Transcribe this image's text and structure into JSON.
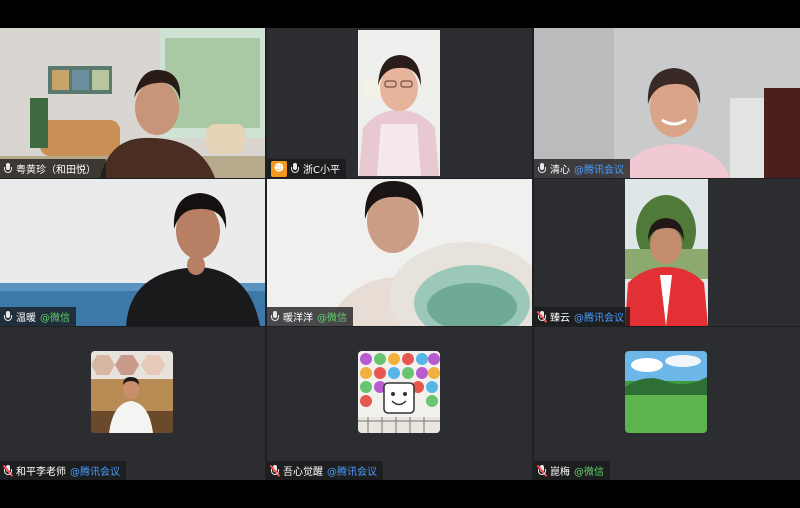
{
  "participants": [
    {
      "name": "粤黄珍（和田悦）",
      "org": ""
    },
    {
      "name": "浙C小平",
      "org": ""
    },
    {
      "name": "清心",
      "org": "@腾讯会议"
    },
    {
      "name": "温暖",
      "org": "@微信"
    },
    {
      "name": "暖洋洋",
      "org": "@微信"
    },
    {
      "name": "臻云",
      "org": "@腾讯会议"
    },
    {
      "name": "和平李老师",
      "org": "@腾讯会议"
    },
    {
      "name": "吾心觉醒",
      "org": "@腾讯会议"
    },
    {
      "name": "崑梅",
      "org": "@微信"
    }
  ],
  "colors": {
    "active_speaker_border": "#2fbf71",
    "wechat_accent": "#5ed26a",
    "tencent_accent": "#4a9bff",
    "host_badge": "#f39a1e"
  },
  "icons": {
    "mic": "mic-icon",
    "mic_muted": "mic-muted-icon",
    "host": "host-icon"
  }
}
